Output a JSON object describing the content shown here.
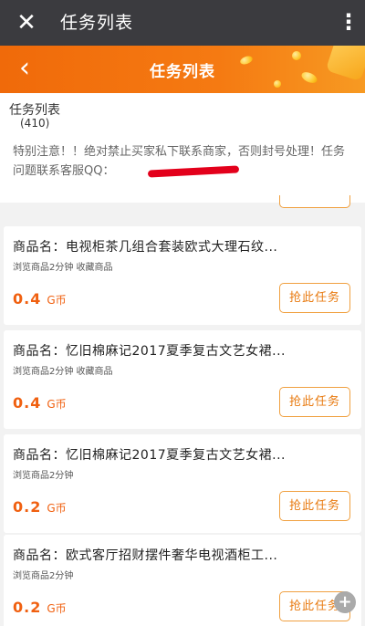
{
  "wechat_bar": {
    "close_icon": "close-icon",
    "title": "任务列表",
    "more_icon": "more-vertical-icon"
  },
  "header": {
    "back_icon": "back-arrow-icon",
    "title": "任务列表"
  },
  "info": {
    "title": "任务列表",
    "count": "(410)",
    "notice": "特别注意！！绝对禁止买家私下联系商家，否则封号处理！任务问题联系客服QQ："
  },
  "tasks": [
    {
      "title": "商品名：电视柜茶几组合套装欧式大理石纹...",
      "tags": "浏览商品2分钟 收藏商品",
      "price": "0.4",
      "unit": "G币",
      "button": "抢此任务"
    },
    {
      "title": "商品名：忆旧棉麻记2017夏季复古文艺女裙...",
      "tags": "浏览商品2分钟 收藏商品",
      "price": "0.4",
      "unit": "G币",
      "button": "抢此任务"
    },
    {
      "title": "商品名：忆旧棉麻记2017夏季复古文艺女裙...",
      "tags": "浏览商品2分钟",
      "price": "0.2",
      "unit": "G币",
      "button": "抢此任务"
    },
    {
      "title": "商品名：欧式客厅招财摆件奢华电视酒柜工...",
      "tags": "浏览商品2分钟",
      "price": "0.2",
      "unit": "G币",
      "button": "抢此任务"
    }
  ],
  "colors": {
    "accent": "#f57a12",
    "price": "#f06010",
    "wechat_bar": "#3b3b3f"
  }
}
